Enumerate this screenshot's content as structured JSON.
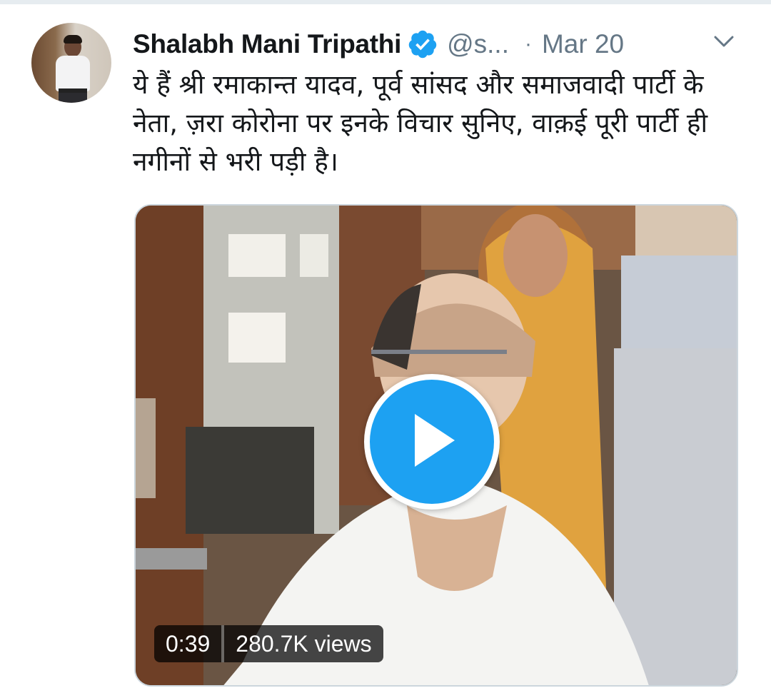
{
  "tweet": {
    "author": {
      "display_name": "Shalabh Mani Tripathi",
      "handle": "@s...",
      "verified": true
    },
    "separator": "·",
    "date": "Mar 20",
    "text": "ये हैं श्री रमाकान्त यादव, पूर्व सांसद और समाजवादी पार्टी के नेता, ज़रा कोरोना पर इनके विचार सुनिए, वाक़ई पूरी पार्टी ही नगीनों से भरी पड़ी है।",
    "media": {
      "type": "video",
      "duration": "0:39",
      "views": "280.7K views"
    }
  },
  "colors": {
    "accent": "#1da1f2",
    "text_primary": "#14171a",
    "text_secondary": "#657786",
    "border": "#ccd6dd"
  },
  "icons": {
    "verified": "verified-badge-icon",
    "menu": "chevron-down-icon",
    "play": "play-icon"
  }
}
